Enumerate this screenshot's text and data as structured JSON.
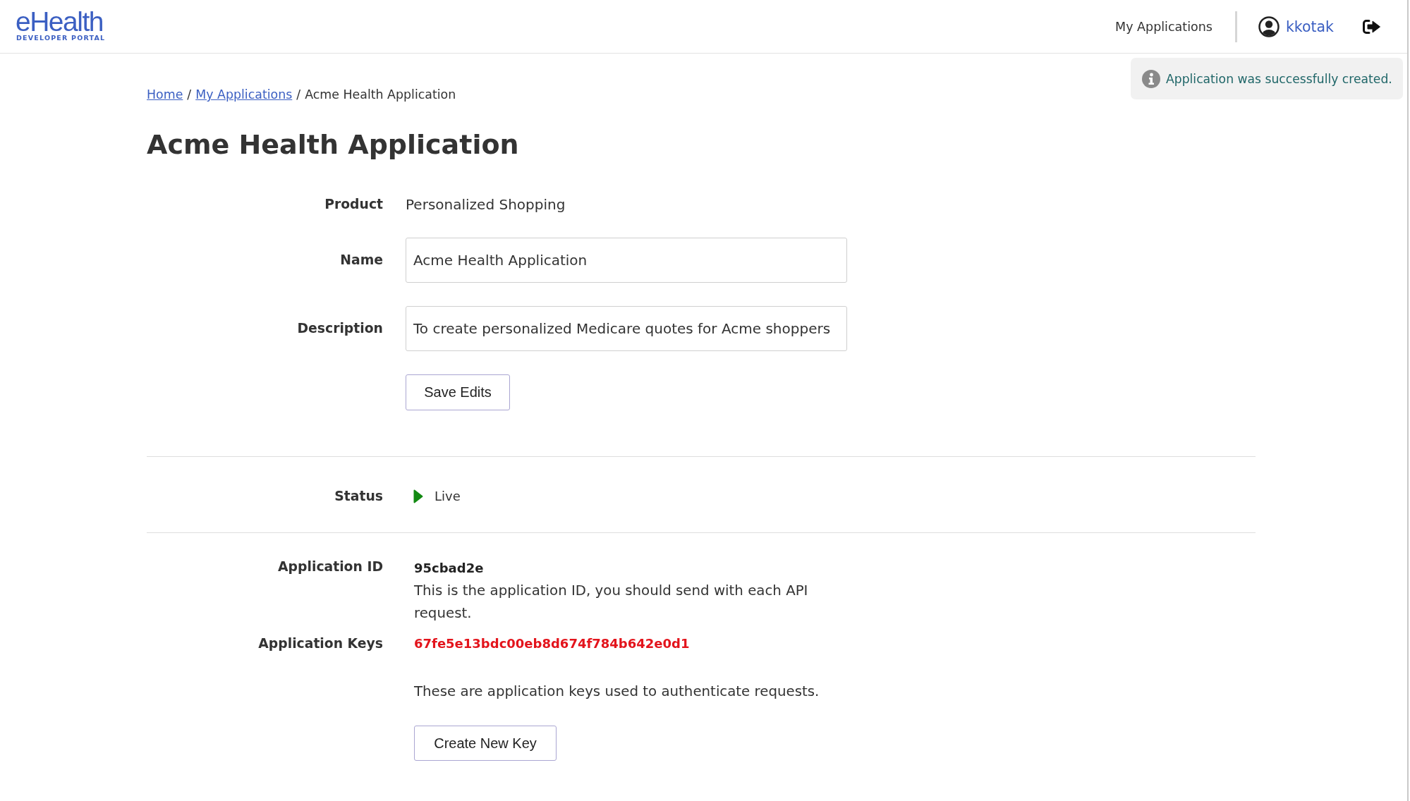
{
  "header": {
    "logo": {
      "wordmark": "eHealth",
      "tagline": "DEVELOPER PORTAL"
    },
    "nav_link": "My Applications",
    "user": "kkotak"
  },
  "toast": {
    "message": "Application was successfully created."
  },
  "breadcrumb": [
    {
      "label": "Home",
      "kind": "link"
    },
    {
      "label": "/",
      "kind": "separator"
    },
    {
      "label": "My Applications",
      "kind": "link"
    },
    {
      "label": "/",
      "kind": "separator"
    },
    {
      "label": "Acme Health Application",
      "kind": "current"
    }
  ],
  "title": "Acme Health Application",
  "details": {
    "product": {
      "label": "Product",
      "value": "Personalized Shopping"
    },
    "name": {
      "label": "Name",
      "value": "Acme Health Application"
    },
    "description": {
      "label": "Description",
      "value": "To create personalized Medicare quotes for Acme shoppers"
    },
    "save_button": "Save Edits"
  },
  "status": {
    "label": "Status",
    "value": "Live"
  },
  "application_id": {
    "label": "Application ID",
    "value": "95cbad2e",
    "note": "This is the application ID, you should send with each API request."
  },
  "application_keys": {
    "label": "Application Keys",
    "keys": [
      "67fe5e13bdc00eb8d674f784b642e0d1"
    ],
    "note": "These are application keys used to authenticate requests.",
    "button": "Create New Key"
  }
}
